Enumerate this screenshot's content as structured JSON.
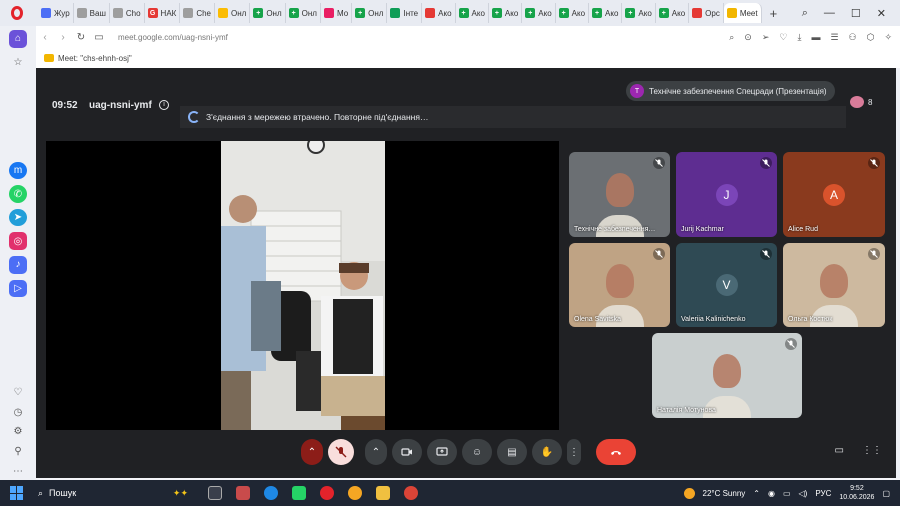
{
  "browser": {
    "tabs": [
      {
        "label": "Жур",
        "color": "#4c6ef5",
        "glyph": ""
      },
      {
        "label": "Ваш",
        "color": "#9e9e9e",
        "glyph": ""
      },
      {
        "label": "Cho",
        "color": "#9e9e9e",
        "glyph": ""
      },
      {
        "label": "НАК",
        "color": "#e53935",
        "glyph": "G"
      },
      {
        "label": "Che",
        "color": "#9e9e9e",
        "glyph": ""
      },
      {
        "label": "Онл",
        "color": "#fbbc04",
        "glyph": ""
      },
      {
        "label": "Онл",
        "color": "#16a34a",
        "glyph": "+"
      },
      {
        "label": "Онл",
        "color": "#16a34a",
        "glyph": "+"
      },
      {
        "label": "Мо",
        "color": "#e91e63",
        "glyph": ""
      },
      {
        "label": "Онл",
        "color": "#16a34a",
        "glyph": "+"
      },
      {
        "label": "Інте",
        "color": "#0f9d58",
        "glyph": ""
      },
      {
        "label": "Ако",
        "color": "#e53935",
        "glyph": ""
      },
      {
        "label": "Ако",
        "color": "#16a34a",
        "glyph": "+"
      },
      {
        "label": "Ако",
        "color": "#16a34a",
        "glyph": "+"
      },
      {
        "label": "Ако",
        "color": "#16a34a",
        "glyph": "+"
      },
      {
        "label": "Ако",
        "color": "#16a34a",
        "glyph": "+"
      },
      {
        "label": "Ако",
        "color": "#16a34a",
        "glyph": "+"
      },
      {
        "label": "Ако",
        "color": "#16a34a",
        "glyph": "+"
      },
      {
        "label": "Ако",
        "color": "#16a34a",
        "glyph": "+"
      },
      {
        "label": "Opc",
        "color": "#e53935",
        "glyph": ""
      },
      {
        "label": "Meet",
        "color": "#f2b600",
        "glyph": "",
        "active": true
      }
    ],
    "url": "meet.google.com/uag-nsni-ymf",
    "bookmark_label": "Meet: \"chs-ehnh-osj\"",
    "window_controls": {
      "search": "⌕",
      "minimize": "—",
      "maximize": "☐",
      "close": "✕"
    },
    "new_tab": "+"
  },
  "meeting": {
    "time": "09:52",
    "code": "uag-nsni-ymf",
    "presenting_badge": "T",
    "presenting_label": "Технічне забезпечення Спецради (Презентація)",
    "participant_count": "8",
    "reconnect_message": "З'єднання з мережею втрачено. Повторне під'єднання…",
    "participants": [
      {
        "name": "Технічне забезпечення…",
        "type": "video",
        "bg": "#6b6f73"
      },
      {
        "name": "Jurij Kachmar",
        "type": "avatar",
        "initial": "J",
        "bg": "#5e2d91",
        "circle": "#7b45b8"
      },
      {
        "name": "Alice Rud",
        "type": "avatar",
        "initial": "A",
        "bg": "#8a3a1e",
        "circle": "#d9532c"
      },
      {
        "name": "Olena Savitska",
        "type": "video",
        "bg": "#bfa384"
      },
      {
        "name": "Valeriia Kalinichenko",
        "type": "avatar",
        "initial": "V",
        "bg": "#2f4a54",
        "circle": "#4a6975"
      },
      {
        "name": "Ольга Костюк",
        "type": "video",
        "bg": "#cdb99f"
      },
      {
        "name": "Наталія Мотунова",
        "type": "video",
        "bg": "#c9cfcf"
      }
    ]
  },
  "taskbar": {
    "search_label": "Пошук",
    "weather": "22°C  Sunny",
    "lang": "РУС",
    "time": "9:52",
    "date": "10.06.2026"
  }
}
